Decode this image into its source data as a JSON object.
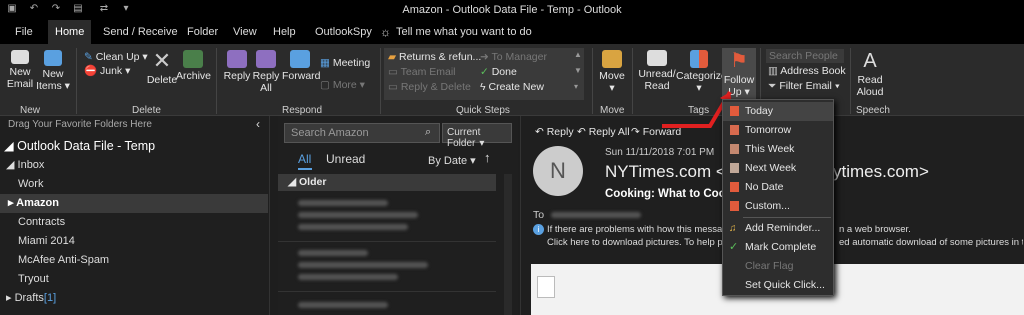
{
  "window": {
    "title": "Amazon - Outlook Data File - Temp  -  Outlook"
  },
  "tabs": [
    "File",
    "Home",
    "Send / Receive",
    "Folder",
    "View",
    "Help",
    "OutlookSpy"
  ],
  "tell_me": "Tell me what you want to do",
  "ribbon": {
    "new_email": "New\nEmail",
    "new_items": "New\nItems ▾",
    "group_new": "New",
    "clean_up": "Clean Up ▾",
    "junk": "Junk ▾",
    "delete": "Delete",
    "archive": "Archive",
    "group_delete": "Delete",
    "reply": "Reply",
    "reply_all": "Reply\nAll",
    "forward": "Forward",
    "meeting": "Meeting",
    "more": "More ▾",
    "group_respond": "Respond",
    "qs_items": [
      "Returns & refun...",
      "Team Email",
      "Reply & Delete",
      "To Manager",
      "Done",
      "Create New"
    ],
    "group_quick": "Quick Steps",
    "move": "Move\n▾",
    "group_move": "Move",
    "unread_read": "Unread/\nRead",
    "categorize": "Categorize\n▾",
    "follow_up": "Follow\nUp ▾",
    "group_tags": "Tags",
    "search_people": "Search People",
    "address_book": "Address Book",
    "filter_email": "Filter Email ▾",
    "read_aloud": "Read\nAloud",
    "group_speech": "Speech"
  },
  "left": {
    "drag_hint": "Drag Your Favorite Folders Here",
    "root": "Outlook Data File - Temp",
    "folders": [
      "Inbox",
      "Work",
      "Amazon",
      "Contracts",
      "Miami 2014",
      "McAfee Anti-Spam",
      "Tryout"
    ],
    "drafts": "Drafts",
    "drafts_count": "[1]"
  },
  "list": {
    "search_placeholder": "Search Amazon",
    "scope": "Current Folder",
    "tab_all": "All",
    "tab_unread": "Unread",
    "sort": "By Date",
    "group": "Older"
  },
  "reading": {
    "reply": "Reply",
    "reply_all": "Reply All",
    "forward": "Forward",
    "avatar": "N",
    "date": "Sun 11/11/2018 7:01 PM",
    "sender_a": "NYTimes.com <n",
    "sender_b": "ytimes.com>",
    "subject": "Cooking: What to Cook",
    "to": "To",
    "info1a": "If there are problems with how this message is d",
    "info1b": "n a web browser.",
    "info2a": "Click here to download pictures. To help protect",
    "info2b": "ed automatic download of some pictures in this mes"
  },
  "menu": {
    "items": [
      "Today",
      "Tomorrow",
      "This Week",
      "Next Week",
      "No Date",
      "Custom...",
      "Add Reminder...",
      "Mark Complete",
      "Clear Flag",
      "Set Quick Click..."
    ]
  },
  "colors": {
    "flag": "#e25b3c",
    "accent": "#5aa0e0",
    "annotation": "#e02020"
  }
}
